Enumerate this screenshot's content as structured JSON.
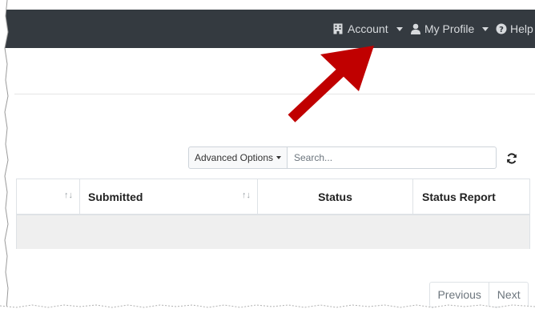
{
  "topnav": {
    "account_label": "Account",
    "profile_label": "My Profile",
    "help_label": "Help"
  },
  "toolbar": {
    "advanced_options_label": "Advanced Options",
    "search_placeholder": "Search..."
  },
  "table": {
    "columns": [
      "Submitted",
      "Status",
      "Status Report"
    ]
  },
  "pagination": {
    "previous_label": "Previous",
    "next_label": "Next"
  },
  "colors": {
    "navbar": "#343a40",
    "arrow": "#c00000"
  }
}
